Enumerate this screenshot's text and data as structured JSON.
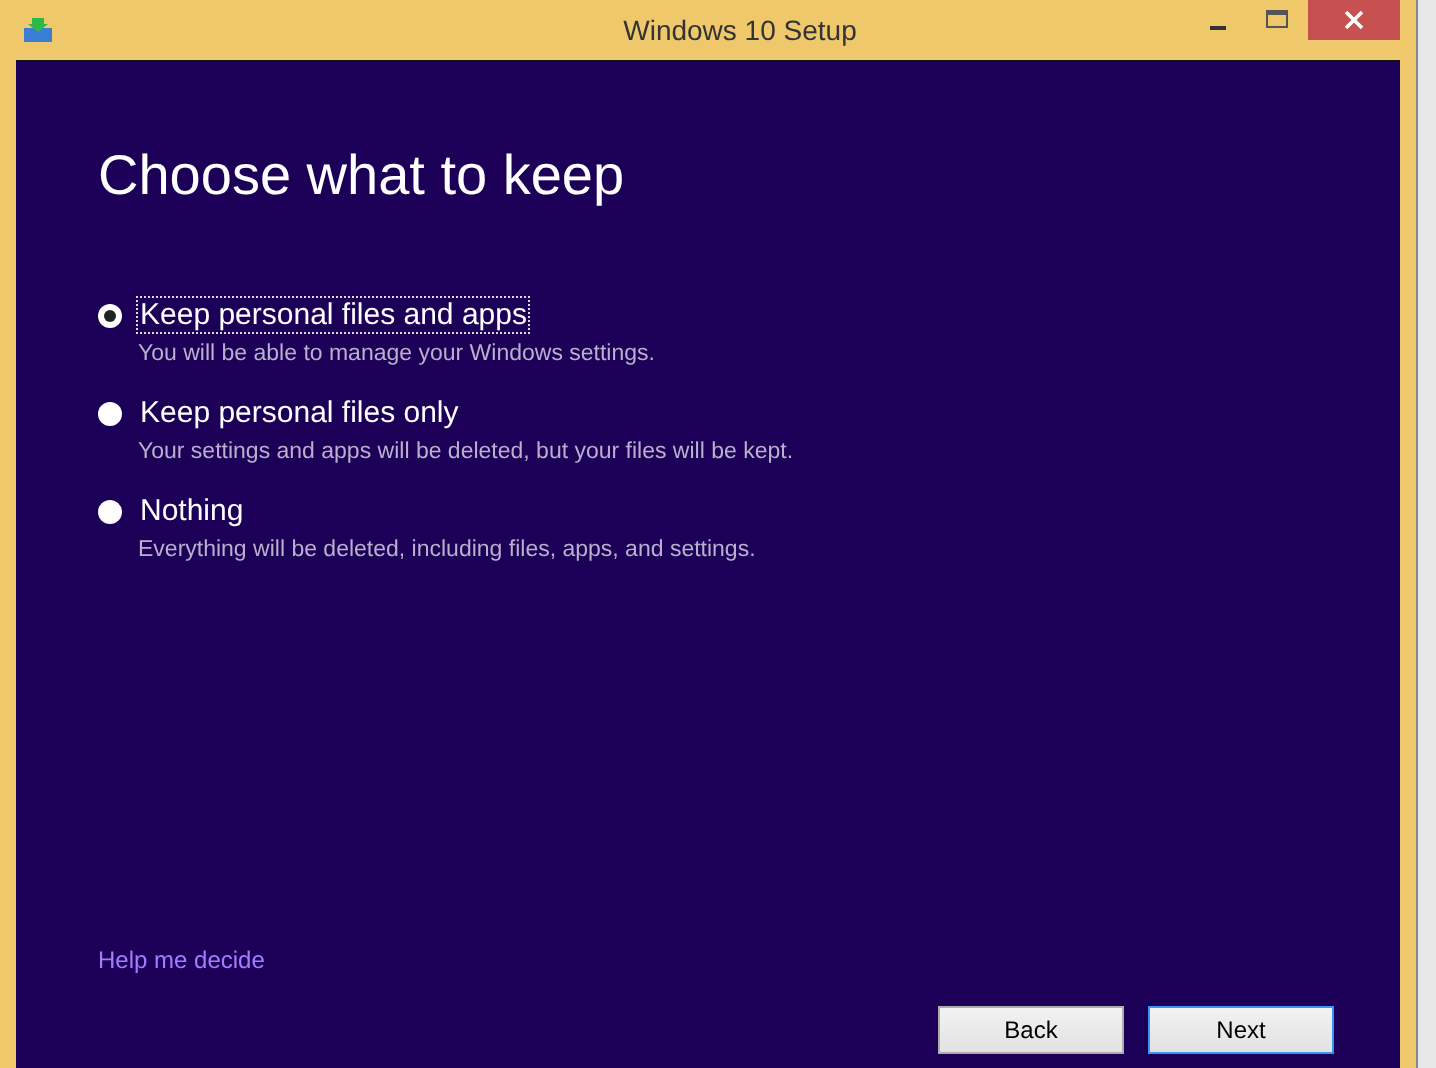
{
  "window": {
    "title": "Windows 10 Setup"
  },
  "heading": "Choose what to keep",
  "options": [
    {
      "label": "Keep personal files and apps",
      "description": "You will be able to manage your Windows settings.",
      "selected": true
    },
    {
      "label": "Keep personal files only",
      "description": "Your settings and apps will be deleted, but your files will be kept.",
      "selected": false
    },
    {
      "label": "Nothing",
      "description": "Everything will be deleted, including files, apps, and settings.",
      "selected": false
    }
  ],
  "help_link": "Help me decide",
  "buttons": [
    {
      "label": "Back",
      "focused": false
    },
    {
      "label": "Next",
      "focused": true
    }
  ]
}
